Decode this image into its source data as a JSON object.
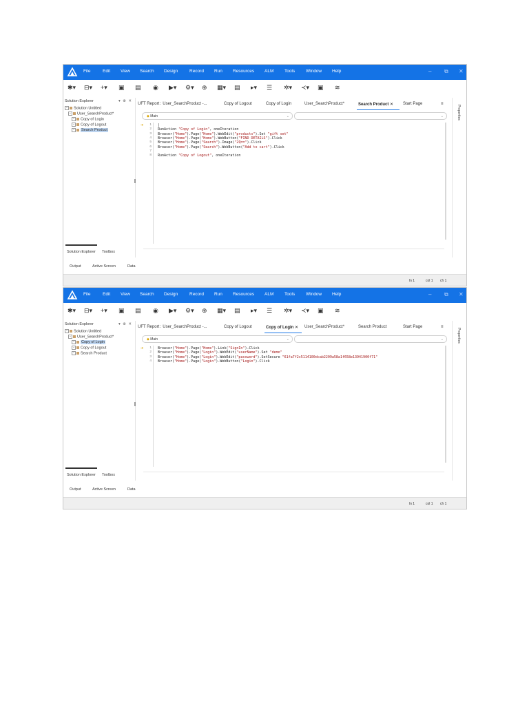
{
  "app": {
    "menu": [
      "File",
      "Edit",
      "View",
      "Search",
      "Design",
      "Record",
      "Run",
      "Resources",
      "ALM",
      "Tools",
      "Window",
      "Help"
    ],
    "solution_explorer": {
      "title": "Solution Explorer",
      "controls": "▾ ⊕ ✕",
      "tabs": [
        "Solution Explorer",
        "Toolbox"
      ]
    },
    "bottom_tabs": [
      "Output",
      "Active Screen",
      "Data"
    ],
    "properties_label": "Properties",
    "status": {
      "ln": "ln 1",
      "col": "col 1",
      "ch": "ch 1"
    },
    "colors": {
      "menubar": "#1473e6",
      "string": "#a31515",
      "method": "#1a1a1a"
    }
  },
  "screens": [
    {
      "tabs": [
        "UFT Report : User_SearchProduct -...",
        "Copy of Logout",
        "Copy of Login",
        "User_SearchProduct*",
        "Search Product",
        "Start Page",
        "≡"
      ],
      "active_tab_index": 4,
      "tree": [
        {
          "label": "Solution Untitled",
          "level": 0,
          "selected": false
        },
        {
          "label": "User_SearchProduct*",
          "level": 1,
          "selected": false
        },
        {
          "label": "Copy of Login",
          "level": 2,
          "selected": false
        },
        {
          "label": "Copy of Logout",
          "level": 2,
          "selected": false
        },
        {
          "label": "Search Product",
          "level": 2,
          "selected": true
        }
      ],
      "editor": {
        "action": "Main",
        "lines": [
          {
            "num": "1",
            "code": "|"
          },
          {
            "num": "2",
            "code": "RunAction \"Copy of Login\", oneIteration"
          },
          {
            "num": "3",
            "code": "Browser(\"Home\").Page(\"Home\").WebEdit(\"products\").Set \"gift set\""
          },
          {
            "num": "4",
            "code": "Browser(\"Home\").Page(\"Home\").WebButton(\"FIND DETAILS\").Click"
          },
          {
            "num": "5",
            "code": "Browser(\"Home\").Page(\"Search\").Image(\"2Q==\").Click"
          },
          {
            "num": "6",
            "code": "Browser(\"Home\").Page(\"Search\").WebButton(\"Add to cart\").Click"
          },
          {
            "num": "7",
            "code": ""
          },
          {
            "num": "8",
            "code": "RunAction \"Copy of Logout\", oneIteration"
          }
        ]
      }
    },
    {
      "tabs": [
        "UFT Report : User_SearchProduct -...",
        "Copy of Logout",
        "Copy of Login",
        "User_SearchProduct*",
        "Search Product",
        "Start Page",
        "≡"
      ],
      "active_tab_index": 2,
      "tree": [
        {
          "label": "Solution Untitled",
          "level": 0,
          "selected": false
        },
        {
          "label": "User_SearchProduct*",
          "level": 1,
          "selected": false
        },
        {
          "label": "Copy of Login",
          "level": 2,
          "selected": true
        },
        {
          "label": "Copy of Logout",
          "level": 2,
          "selected": false
        },
        {
          "label": "Search Product",
          "level": 2,
          "selected": false
        }
      ],
      "editor": {
        "action": "Main",
        "lines": [
          {
            "num": "1",
            "code": "Browser(\"Home\").Page(\"Home\").Link(\"SignIn\").Click"
          },
          {
            "num": "2",
            "code": "Browser(\"Home\").Page(\"Login\").WebEdit(\"userName\").Set \"demo\""
          },
          {
            "num": "3",
            "code": "Browser(\"Home\").Page(\"Login\").WebEdit(\"password\").SetSecure \"61fa7f2c5114100dcab2209a58a1f658e13941900f71\""
          },
          {
            "num": "4",
            "code": "Browser(\"Home\").Page(\"Login\").WebButton(\"Login\").Click"
          }
        ]
      }
    }
  ]
}
